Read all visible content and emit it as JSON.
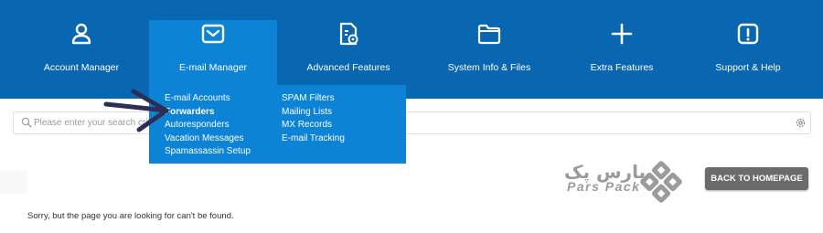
{
  "nav": {
    "items": [
      {
        "label": "Account Manager",
        "icon": "user-icon"
      },
      {
        "label": "E-mail Manager",
        "icon": "envelope-icon"
      },
      {
        "label": "Advanced Features",
        "icon": "file-settings-icon"
      },
      {
        "label": "System Info & Files",
        "icon": "folder-icon"
      },
      {
        "label": "Extra Features",
        "icon": "plus-icon"
      },
      {
        "label": "Support & Help",
        "icon": "alert-icon"
      }
    ],
    "active": "E-mail Manager"
  },
  "email_menu": {
    "left": [
      "E-mail Accounts",
      "Forwarders",
      "Autoresponders",
      "Vacation Messages",
      "Spamassassin Setup"
    ],
    "right": [
      "SPAM Filters",
      "Mailing Lists",
      "MX Records",
      "E-mail Tracking"
    ]
  },
  "search": {
    "placeholder": "Please enter your search crit"
  },
  "logo": {
    "persian_text": "پارس پک",
    "latin_text": "Pars Pack"
  },
  "home_button": {
    "label": "BACK TO HOMEPAGE"
  },
  "message": "Sorry, but the page you are looking for can't be found.",
  "colors": {
    "topbar": "#0966b0",
    "active_menu": "#0c83d4",
    "button": "#6b6b6b",
    "arrow": "#2c2f55",
    "logo": "#9b9b9b"
  }
}
